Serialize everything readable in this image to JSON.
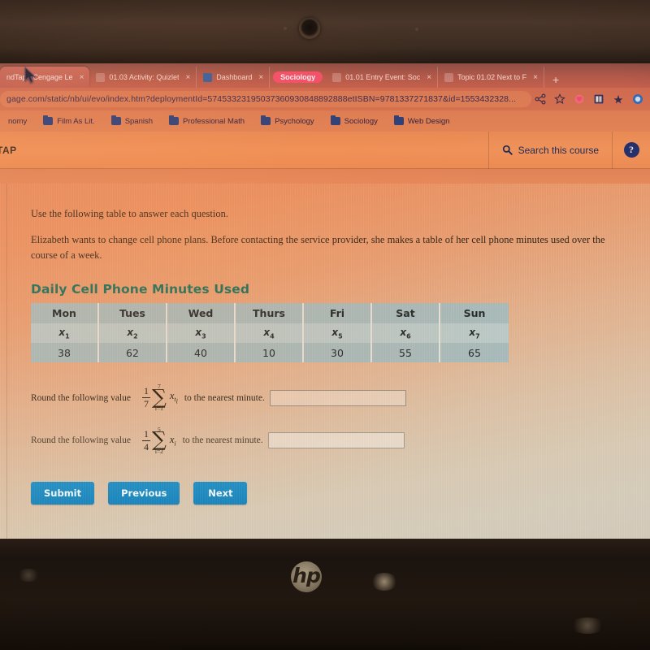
{
  "browser": {
    "tabs": [
      {
        "title": "ndTap - Cengage Le",
        "favicon": "mindtap-icon",
        "active": true,
        "close": "×",
        "type": "tab"
      },
      {
        "title": "01.03 Activity: Quizlet",
        "favicon": "quizlet-icon",
        "active": false,
        "close": "×",
        "type": "tab"
      },
      {
        "title": "Dashboard",
        "favicon": "dashboard-icon",
        "active": false,
        "close": "×",
        "type": "tab"
      },
      {
        "title": "Sociology",
        "favicon": "",
        "active": false,
        "close": "×",
        "type": "pill"
      },
      {
        "title": "01.01 Entry Event: Soc",
        "favicon": "flvs-icon",
        "active": false,
        "close": "×",
        "type": "tab"
      },
      {
        "title": "Topic 01.02 Next to F",
        "favicon": "flvs-icon",
        "active": false,
        "close": "×",
        "type": "tab"
      }
    ],
    "new_tab_label": "+",
    "url": "gage.com/static/nb/ui/evo/index.htm?deploymentId=57453323195037360930848892888etISBN=9781337271837&id=1553432328...",
    "toolbar_icons": [
      "share-icon",
      "star-icon",
      "extension-pink-icon",
      "extension-book-icon",
      "extension-star-icon",
      "profile-icon"
    ],
    "bookmarks": [
      {
        "label": "nomy",
        "icon": "folder-icon"
      },
      {
        "label": "Film As Lit.",
        "icon": "folder-icon"
      },
      {
        "label": "Spanish",
        "icon": "folder-icon"
      },
      {
        "label": "Professional Math",
        "icon": "folder-icon"
      },
      {
        "label": "Psychology",
        "icon": "folder-icon"
      },
      {
        "label": "Sociology",
        "icon": "folder-icon"
      },
      {
        "label": "Web Design",
        "icon": "folder-icon"
      }
    ]
  },
  "app_header": {
    "brand": "TAP",
    "search_label": "Search this course",
    "search_icon": "search-icon",
    "help_label": "?",
    "help_icon": "help-icon"
  },
  "content": {
    "instruction": "Use the following table to answer each question.",
    "scenario": "Elizabeth wants to change cell phone plans. Before contacting the service provider, she makes a table of her cell phone minutes used over the course of a week.",
    "table": {
      "title": "Daily Cell Phone Minutes Used",
      "days": [
        "Mon",
        "Tues",
        "Wed",
        "Thurs",
        "Fri",
        "Sat",
        "Sun"
      ],
      "variables": [
        {
          "base": "x",
          "sub": "1"
        },
        {
          "base": "x",
          "sub": "2"
        },
        {
          "base": "x",
          "sub": "3"
        },
        {
          "base": "x",
          "sub": "4"
        },
        {
          "base": "x",
          "sub": "5"
        },
        {
          "base": "x",
          "sub": "6"
        },
        {
          "base": "x",
          "sub": "7"
        }
      ],
      "values": [
        "38",
        "62",
        "40",
        "10",
        "30",
        "55",
        "65"
      ]
    },
    "questions": [
      {
        "lead": "Round the following value",
        "coefficient_num": "1",
        "coefficient_den": "7",
        "sigma": "∑",
        "upper": "7",
        "lower": "i=1",
        "term_base": "x",
        "term_sub": "t",
        "term_subsub": "i",
        "tail": "to the nearest minute.",
        "answer_value": "",
        "answer_placeholder": ""
      },
      {
        "lead": "Round the following value",
        "coefficient_num": "1",
        "coefficient_den": "4",
        "sigma": "∑",
        "upper": "5",
        "lower": "i=2",
        "term_base": "x",
        "term_sub": "i",
        "term_subsub": "",
        "tail": "to the nearest minute.",
        "answer_value": "",
        "answer_placeholder": ""
      }
    ],
    "buttons": [
      {
        "label": "Submit"
      },
      {
        "label": "Previous"
      },
      {
        "label": "Next"
      }
    ]
  },
  "device": {
    "brand_mark": "hp",
    "webcam_icon": "webcam-icon"
  },
  "colors": {
    "table_title": "#17705c",
    "table_header_bg": "#a9bcbb",
    "table_alt_bg": "#bccac7",
    "button_blue": "#2391c6",
    "tab_pill": "#f2506b",
    "help_navy": "#26306b"
  }
}
